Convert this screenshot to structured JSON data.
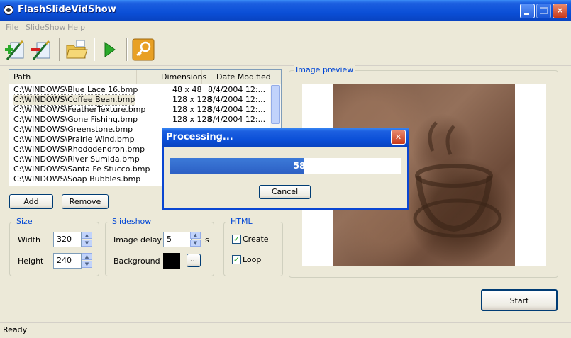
{
  "window": {
    "title": "FlashSlideVidShow"
  },
  "menu": [
    "File",
    "SlideShow",
    "Help"
  ],
  "toolbar": [
    {
      "icon": "add-files-icon"
    },
    {
      "icon": "remove-files-icon"
    },
    {
      "icon": "open-folder-icon"
    },
    {
      "icon": "play-icon"
    },
    {
      "icon": "key-icon"
    }
  ],
  "filelist": {
    "columns": [
      "Path",
      "Dimensions",
      "Date Modified"
    ],
    "rows": [
      {
        "path": "C:\\WINDOWS\\Blue Lace 16.bmp",
        "dim": "48 x 48",
        "date": "8/4/2004 12:..."
      },
      {
        "path": "C:\\WINDOWS\\Coffee Bean.bmp",
        "dim": "128 x 128",
        "date": "8/4/2004 12:..."
      },
      {
        "path": "C:\\WINDOWS\\FeatherTexture.bmp",
        "dim": "128 x 128",
        "date": "8/4/2004 12:..."
      },
      {
        "path": "C:\\WINDOWS\\Gone Fishing.bmp",
        "dim": "128 x 128",
        "date": "8/4/2004 12:..."
      },
      {
        "path": "C:\\WINDOWS\\Greenstone.bmp",
        "dim": "",
        "date": ""
      },
      {
        "path": "C:\\WINDOWS\\Prairie Wind.bmp",
        "dim": "",
        "date": ""
      },
      {
        "path": "C:\\WINDOWS\\Rhododendron.bmp",
        "dim": "",
        "date": ""
      },
      {
        "path": "C:\\WINDOWS\\River Sumida.bmp",
        "dim": "",
        "date": ""
      },
      {
        "path": "C:\\WINDOWS\\Santa Fe Stucco.bmp",
        "dim": "",
        "date": ""
      },
      {
        "path": "C:\\WINDOWS\\Soap Bubbles.bmp",
        "dim": "",
        "date": ""
      }
    ],
    "selected_index": 1
  },
  "buttons": {
    "add": "Add",
    "remove": "Remove",
    "start": "Start",
    "browse": "..."
  },
  "size": {
    "label": "Size",
    "width_label": "Width",
    "width_value": "320",
    "height_label": "Height",
    "height_value": "240"
  },
  "slideshow": {
    "label": "Slideshow",
    "delay_label": "Image delay",
    "delay_value": "5",
    "delay_unit": "s",
    "background_label": "Background",
    "background_color": "#000000"
  },
  "html": {
    "label": "HTML",
    "create_label": "Create",
    "create_checked": true,
    "loop_label": "Loop",
    "loop_checked": true
  },
  "preview": {
    "label": "Image preview"
  },
  "dialog": {
    "title": "Processing...",
    "progress_percent": 58,
    "progress_text": "58%",
    "cancel_label": "Cancel"
  },
  "status": {
    "text": "Ready"
  }
}
